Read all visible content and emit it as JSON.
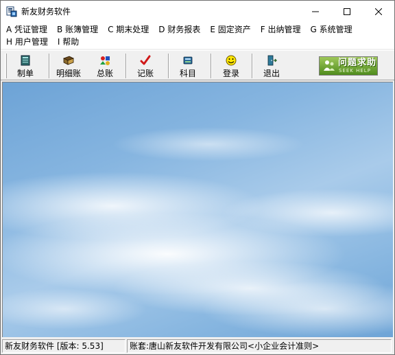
{
  "window": {
    "title": "新友财务软件"
  },
  "menu": {
    "row1": [
      {
        "label": "A 凭证管理"
      },
      {
        "label": "B 账簿管理"
      },
      {
        "label": "C 期末处理"
      },
      {
        "label": "D 财务报表"
      },
      {
        "label": "E 固定资产"
      },
      {
        "label": "F 出纳管理"
      },
      {
        "label": "G 系统管理"
      }
    ],
    "row2": [
      {
        "label": "H 用户管理"
      },
      {
        "label": "I 帮助"
      }
    ]
  },
  "toolbar": {
    "buttons": [
      {
        "label": "制单",
        "icon": "voucher-icon"
      },
      {
        "label": "明细账",
        "icon": "ledger-book-icon"
      },
      {
        "label": "总账",
        "icon": "general-ledger-icon"
      },
      {
        "label": "记账",
        "icon": "checkmark-icon"
      },
      {
        "label": "科目",
        "icon": "accounts-icon"
      },
      {
        "label": "登录",
        "icon": "smiley-icon"
      },
      {
        "label": "退出",
        "icon": "exit-door-icon"
      }
    ],
    "help_button": {
      "label": "问题求助",
      "sublabel": "SEEK HELP"
    }
  },
  "status": {
    "app_version": "新友财务软件 [版本: 5.53]",
    "account_set": "账套:唐山新友软件开发有限公司<小企业会计准则>"
  },
  "colors": {
    "help_button": "#6aa82c",
    "sky": "#86b5e0"
  }
}
